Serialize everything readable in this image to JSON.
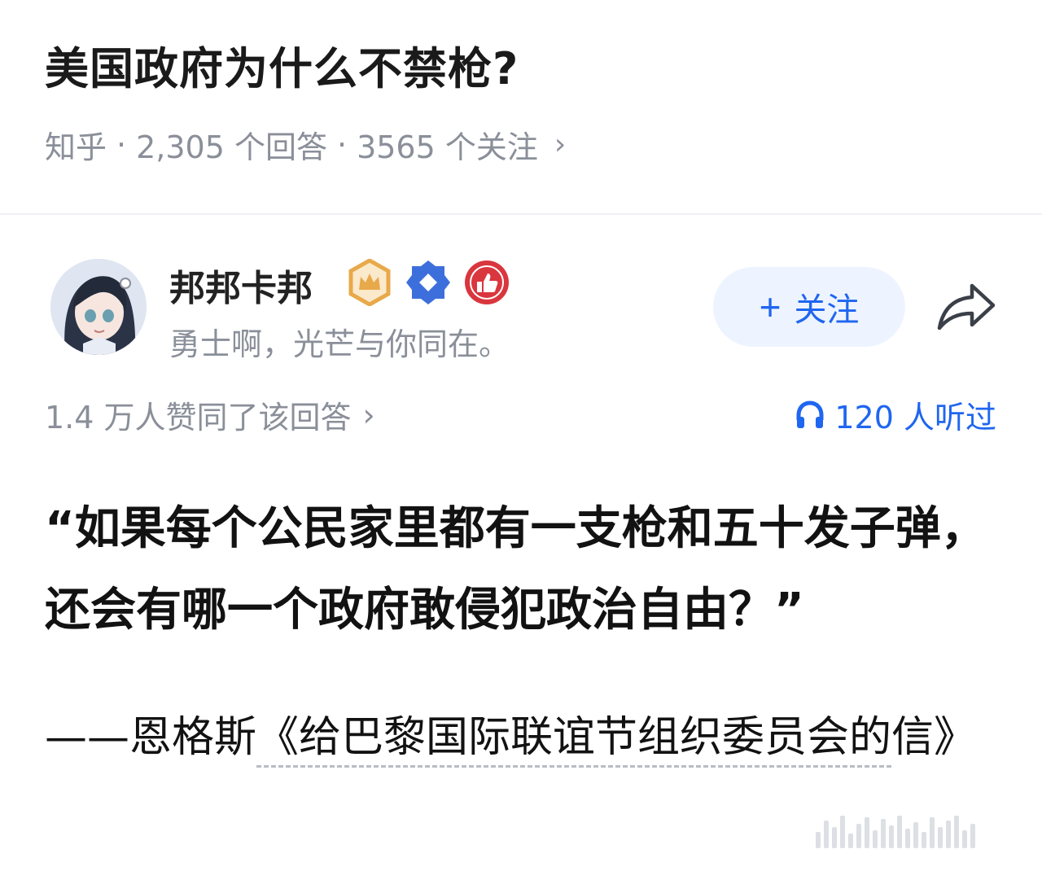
{
  "question": {
    "title": "美国政府为什么不禁枪?",
    "source": "知乎",
    "answers": "2,305 个回答",
    "follows": "3565 个关注",
    "separator": "·",
    "chevron": "›"
  },
  "author": {
    "name": "邦邦卡邦",
    "bio": "勇士啊，光芒与你同在。",
    "badges": [
      "crown-badge-icon",
      "diamond-badge-icon",
      "thumbs-up-badge-icon"
    ],
    "follow_label": "关注",
    "follow_plus": "+"
  },
  "answer_meta": {
    "votes": "1.4 万人赞同了该回答",
    "chevron": "›",
    "listens": "120 人听过"
  },
  "content": {
    "quote": "“如果每个公民家里都有一支枪和五十发子弹，还会有哪一个政府敢侵犯政治自由？”",
    "source_prefix": "——恩格斯",
    "source_link": "《给巴黎国际联谊节组织委员会的",
    "source_suffix": "信》"
  },
  "colors": {
    "accent": "#1f66f0",
    "meta_gray": "#8a8f99",
    "follow_bg": "#eef4ff",
    "crown_badge": "#e8a94a",
    "diamond_badge": "#3d6fdc",
    "thumb_badge": "#d9363e"
  }
}
